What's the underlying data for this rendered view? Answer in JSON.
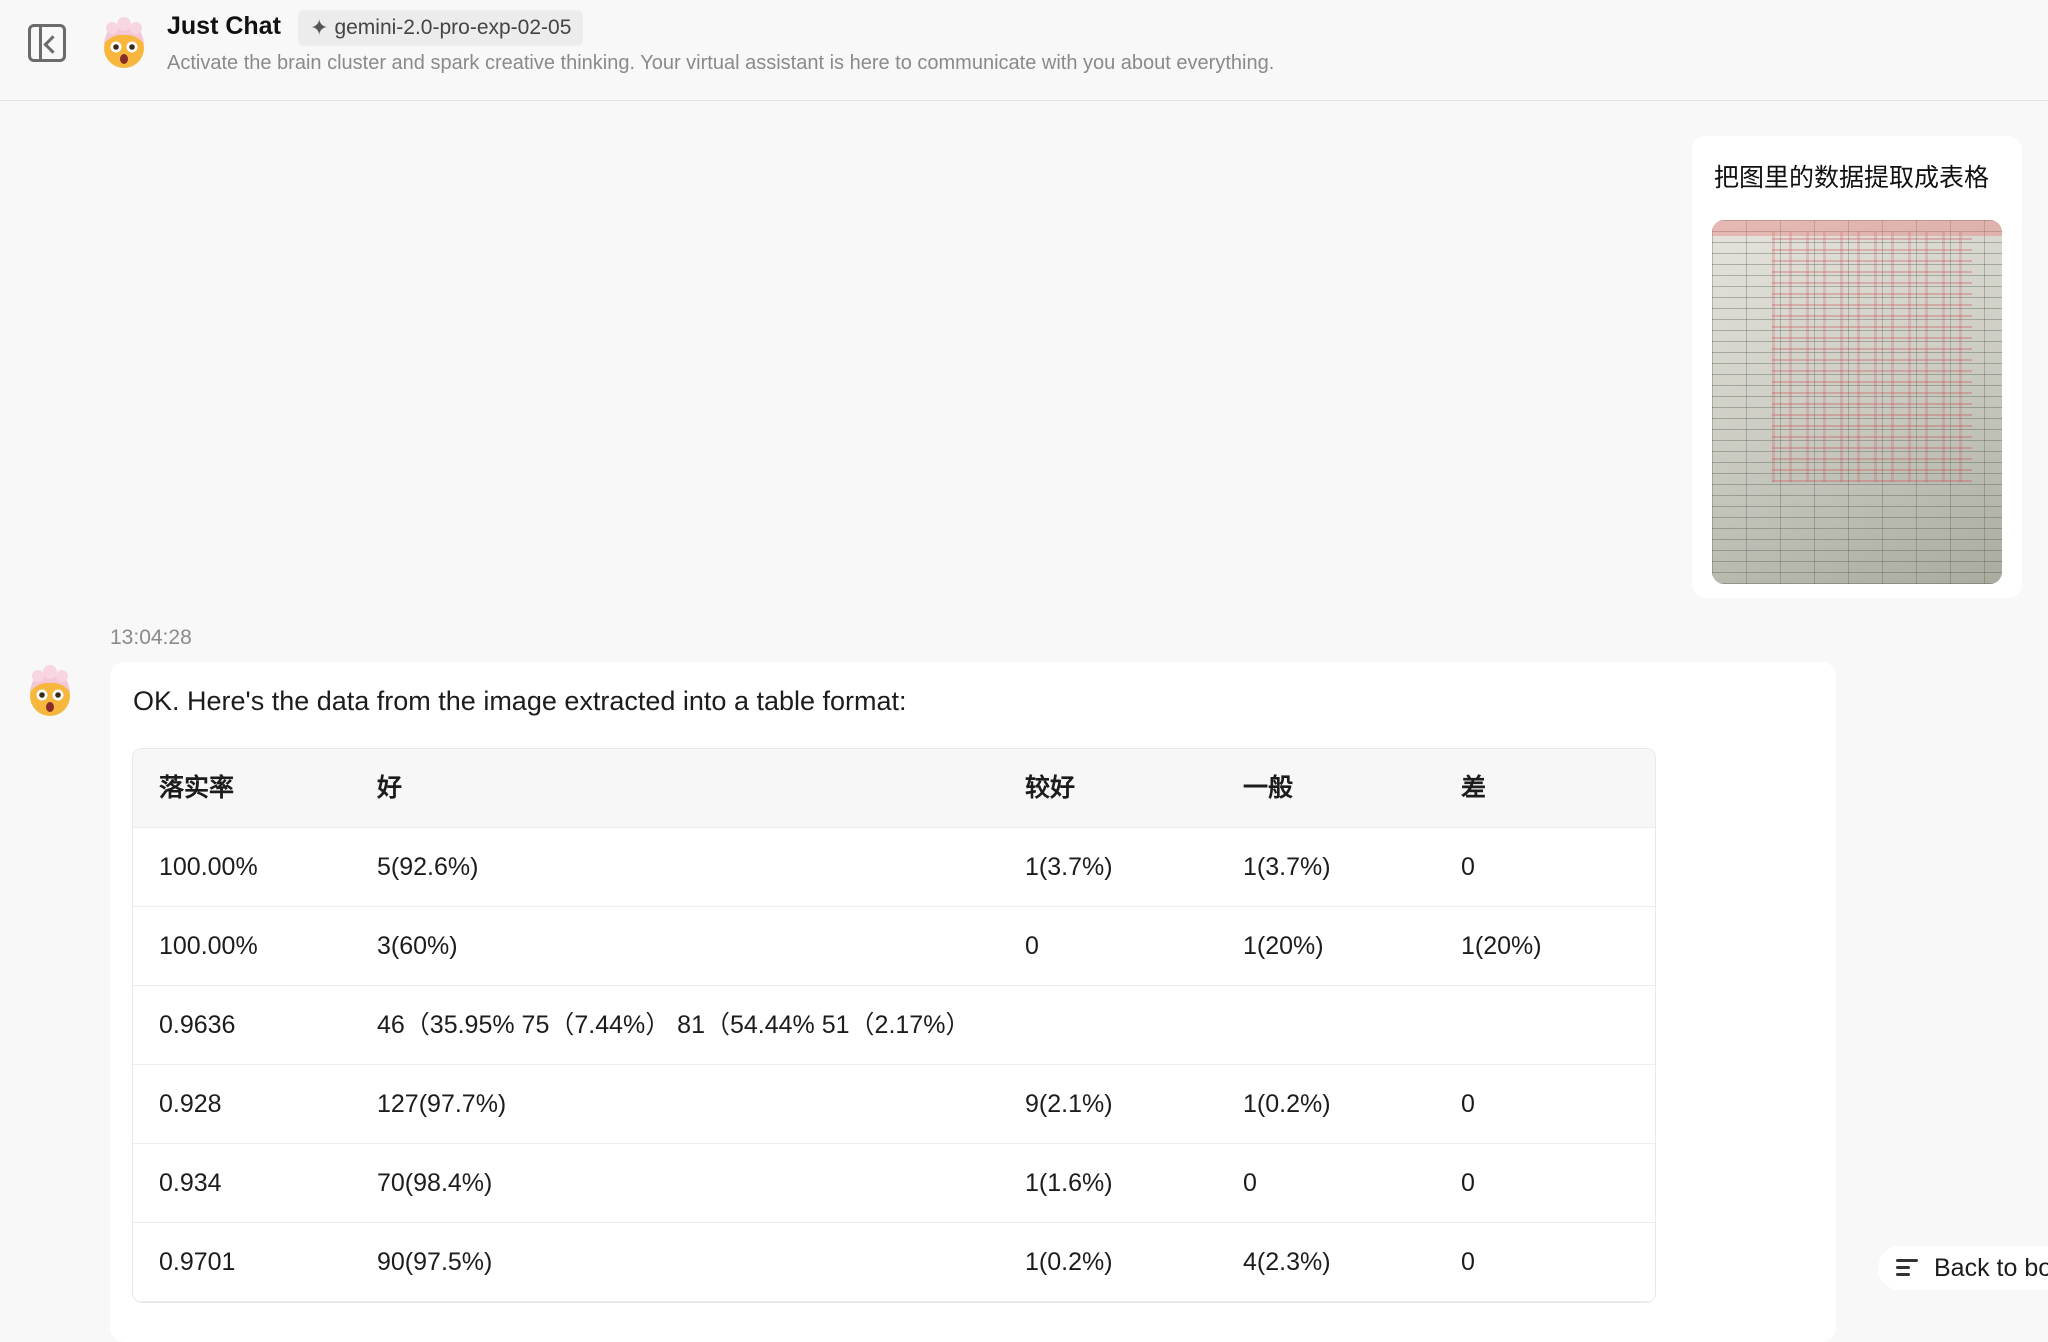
{
  "header": {
    "title": "Just Chat",
    "model": "gemini-2.0-pro-exp-02-05",
    "subtitle": "Activate the brain cluster and spark creative thinking. Your virtual assistant is here to communicate with you about everything."
  },
  "icons": {
    "sidebar_toggle": "sidebar-collapse-icon",
    "model": "sparkle-icon",
    "avatar": "mind-blown-emoji-avatar",
    "back": "list-scroll-icon"
  },
  "user_message": {
    "text": "把图里的数据提取成表格"
  },
  "assistant_message": {
    "timestamp": "13:04:28",
    "intro": "OK. Here's the data from the image extracted into a table format:",
    "table": {
      "columns": [
        "落实率",
        "好",
        "较好",
        "一般",
        "差"
      ],
      "rows": [
        [
          "100.00%",
          "5(92.6%)",
          "1(3.7%)",
          "1(3.7%)",
          "0"
        ],
        [
          "100.00%",
          "3(60%)",
          "0",
          "1(20%)",
          "1(20%)"
        ],
        [
          "0.9636",
          "46（35.95% 75（7.44%） 81（54.44% 51（2.17%）",
          "",
          "",
          ""
        ],
        [
          "0.928",
          "127(97.7%)",
          "9(2.1%)",
          "1(0.2%)",
          "0"
        ],
        [
          "0.934",
          "70(98.4%)",
          "1(1.6%)",
          "0",
          "0"
        ],
        [
          "0.9701",
          "90(97.5%)",
          "1(0.2%)",
          "4(2.3%)",
          "0"
        ]
      ]
    }
  },
  "back_button": {
    "label": "Back to bottom"
  }
}
